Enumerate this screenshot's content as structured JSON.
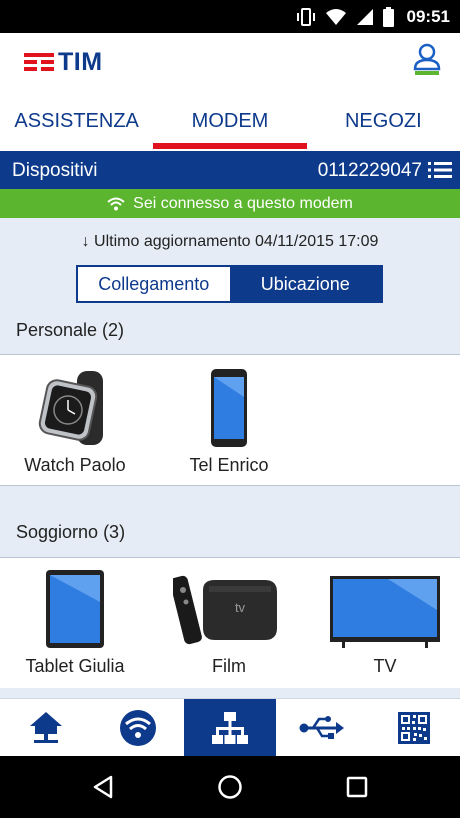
{
  "status_bar": {
    "time": "09:51"
  },
  "header": {
    "logo_text": "TIM"
  },
  "tabs": [
    {
      "label": "ASSISTENZA",
      "active": false
    },
    {
      "label": "MODEM",
      "active": true
    },
    {
      "label": "NEGOZI",
      "active": false
    }
  ],
  "device_bar": {
    "title": "Dispositivi",
    "line_number": "0112229047"
  },
  "connection": {
    "text": "Sei connesso a questo modem"
  },
  "last_update": {
    "text": "Ultimo aggiornamento 04/11/2015 17:09"
  },
  "view_toggle": {
    "options": [
      "Collegamento",
      "Ubicazione"
    ],
    "selected": "Ubicazione"
  },
  "rooms": [
    {
      "title": "Personale (2)",
      "devices": [
        {
          "label": "Watch Paolo",
          "icon": "smartwatch-icon"
        },
        {
          "label": "Tel Enrico",
          "icon": "smartphone-icon"
        }
      ]
    },
    {
      "title": "Soggiorno (3)",
      "devices": [
        {
          "label": "Tablet Giulia",
          "icon": "tablet-icon"
        },
        {
          "label": "Film",
          "icon": "tv-box-icon"
        },
        {
          "label": "TV",
          "icon": "television-icon"
        }
      ]
    }
  ],
  "bottom_nav": [
    {
      "icon": "home-network-icon",
      "active": false
    },
    {
      "icon": "wifi-icon",
      "active": false
    },
    {
      "icon": "lan-network-icon",
      "active": true
    },
    {
      "icon": "usb-icon",
      "active": false
    },
    {
      "icon": "qr-code-icon",
      "active": false
    }
  ],
  "colors": {
    "brand_blue": "#0e3a8c",
    "brand_red": "#e0121d",
    "connected_green": "#5bb52e",
    "section_bg": "#e5ecf5"
  }
}
